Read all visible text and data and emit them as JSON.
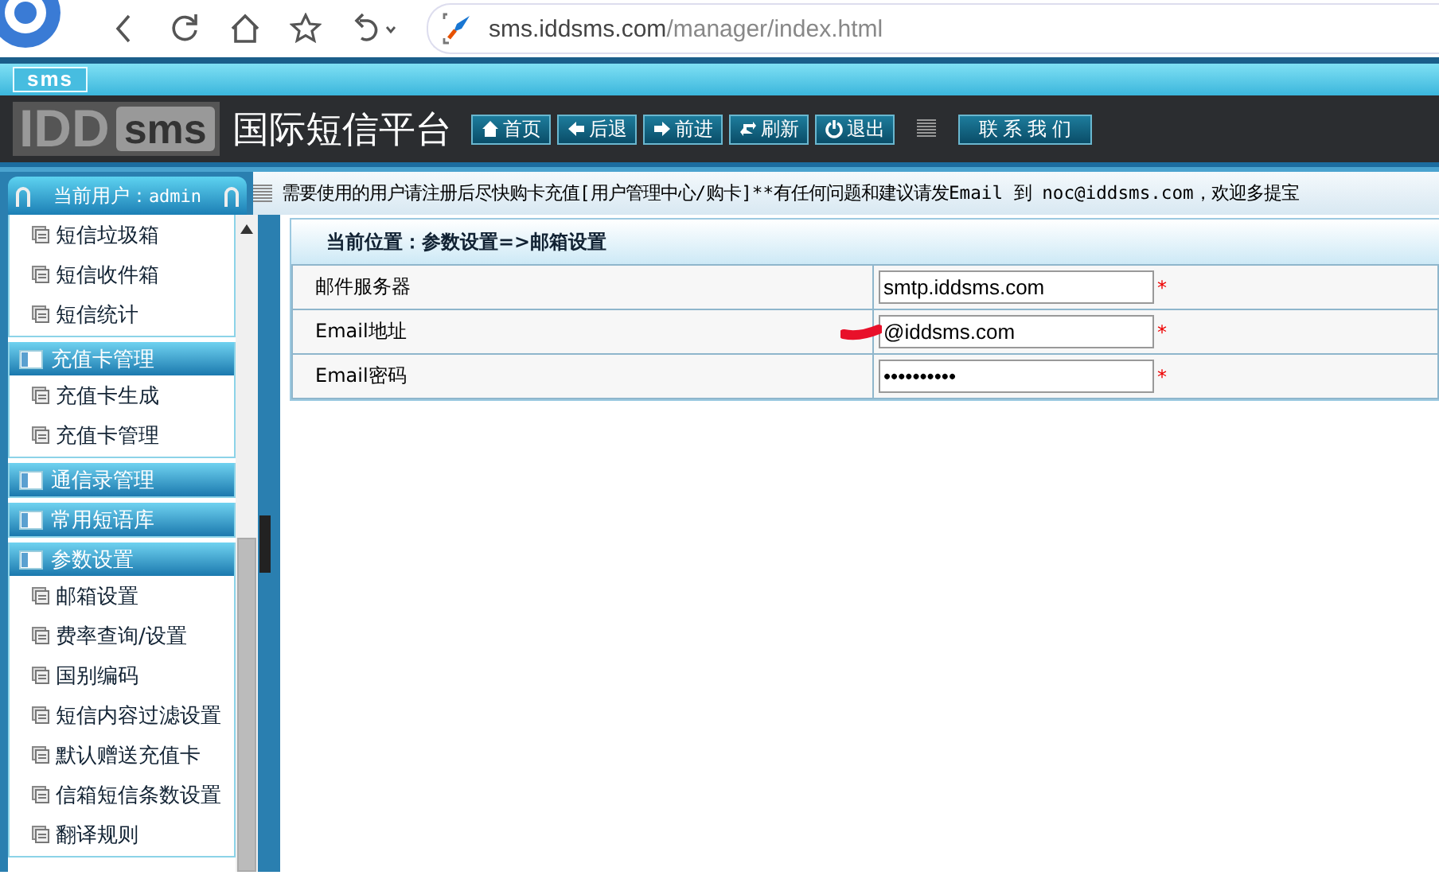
{
  "browser": {
    "url_host": "sms.iddsms.com",
    "url_path": "/manager/index.html"
  },
  "header": {
    "small_logo": "sms",
    "logo_left": "IDD",
    "logo_right": "sms",
    "title": "国际短信平台",
    "nav": [
      {
        "kind": "home",
        "label": "首页"
      },
      {
        "kind": "back",
        "label": "后退"
      },
      {
        "kind": "forward",
        "label": "前进"
      },
      {
        "kind": "refresh",
        "label": "刷新"
      },
      {
        "kind": "power",
        "label": "退出"
      }
    ],
    "contact": "联 系 我 们"
  },
  "user_tab": {
    "label": "当前用户：",
    "user": "admin"
  },
  "notice": "需要使用的用户请注册后尽快购卡充值[用户管理中心/购卡]**有任何问题和建议请发Email 到 noc@iddsms.com，欢迎多提宝",
  "sidebar": {
    "groups": [
      {
        "items": [
          "短信垃圾箱",
          "短信收件箱",
          "短信统计"
        ]
      },
      {
        "title": "充值卡管理",
        "items": [
          "充值卡生成",
          "充值卡管理"
        ]
      },
      {
        "title": "通信录管理"
      },
      {
        "title": "常用短语库"
      },
      {
        "title": "参数设置",
        "items": [
          "邮箱设置",
          "费率查询/设置",
          "国别编码",
          "短信内容过滤设置",
          "默认赠送充值卡",
          "信箱短信条数设置",
          "翻译规则"
        ]
      }
    ]
  },
  "breadcrumb": "当前位置：参数设置=>邮箱设置",
  "form": {
    "rows": [
      {
        "label": "邮件服务器",
        "value": "smtp.iddsms.com",
        "required": "*",
        "redacted": false
      },
      {
        "label": "Email地址",
        "value": "@iddsms.com",
        "required": "*",
        "redacted": true
      },
      {
        "label": "Email密码",
        "value": "••••••••••",
        "required": "*",
        "redacted": false
      }
    ]
  }
}
